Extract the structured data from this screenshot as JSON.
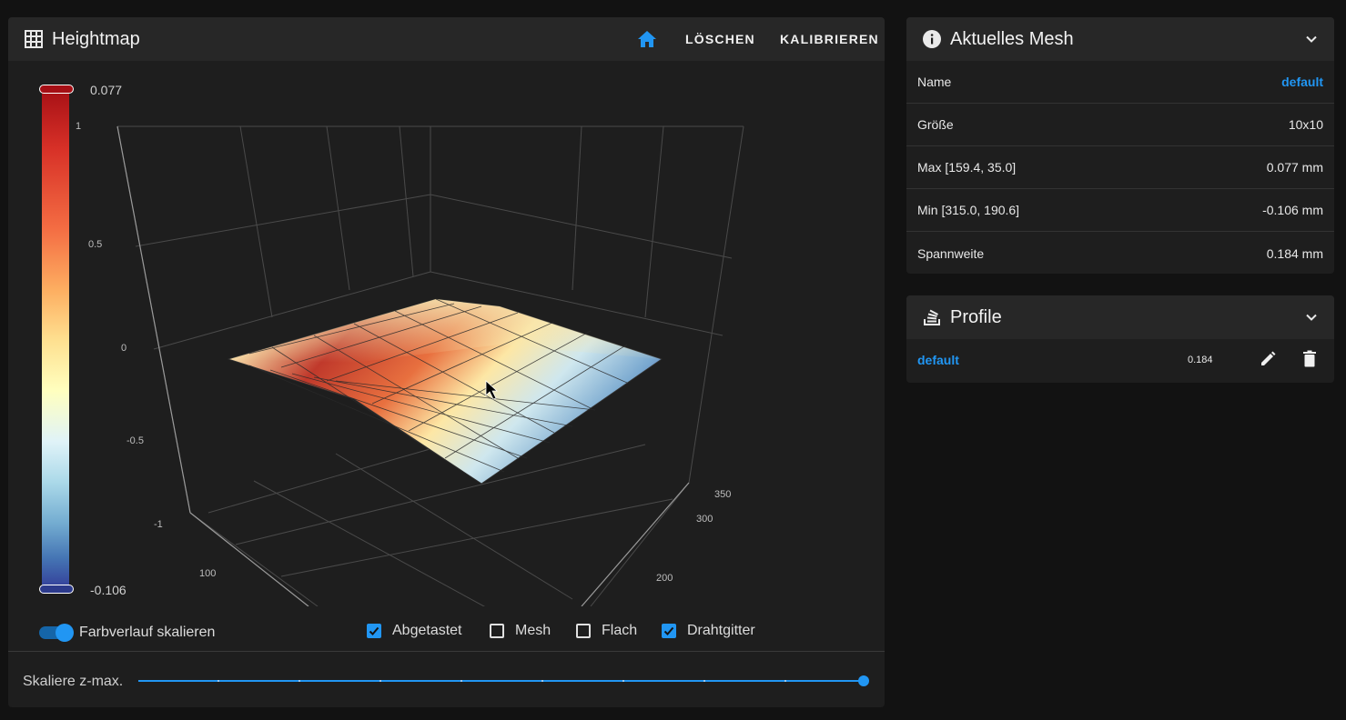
{
  "heightmap": {
    "title": "Heightmap",
    "buttons": {
      "delete": "LÖSCHEN",
      "calibrate": "KALIBRIEREN"
    },
    "colorbar": {
      "max_label": "0.077",
      "min_label": "-0.106",
      "colors": [
        "#a50f15",
        "#e8543a",
        "#fdd38a",
        "#ffffcc",
        "#d9f0f5",
        "#7fb0d5",
        "#3a4fa0",
        "#2c3a8c"
      ]
    },
    "z_ticks": [
      "1",
      "0.5",
      "0",
      "-0.5",
      "-1"
    ],
    "x_ticks": [
      "100"
    ],
    "y_ticks": [
      "350",
      "300",
      "200"
    ],
    "options": {
      "scale_gradient_label": "Farbverlauf skalieren",
      "scale_gradient": true,
      "probed_label": "Abgetastet",
      "probed": true,
      "mesh_label": "Mesh",
      "mesh": false,
      "flat_label": "Flach",
      "flat": false,
      "wireframe_label": "Drahtgitter",
      "wireframe": true
    },
    "zmax": {
      "label": "Skaliere z-max.",
      "value": 1.0
    }
  },
  "current_mesh": {
    "title": "Aktuelles Mesh",
    "rows": [
      {
        "label": "Name",
        "value": "default"
      },
      {
        "label": "Größe",
        "value": "10x10"
      },
      {
        "label": "Max [159.4, 35.0]",
        "value": "0.077 mm"
      },
      {
        "label": "Min [315.0, 190.6]",
        "value": "-0.106 mm"
      },
      {
        "label": "Spannweite",
        "value": "0.184 mm"
      }
    ]
  },
  "profiles": {
    "title": "Profile",
    "items": [
      {
        "name": "default",
        "range": "0.184"
      }
    ]
  },
  "colors": {
    "accent": "#2196f3",
    "card": "#1e1e1e",
    "header": "#272727",
    "background": "#121212"
  }
}
